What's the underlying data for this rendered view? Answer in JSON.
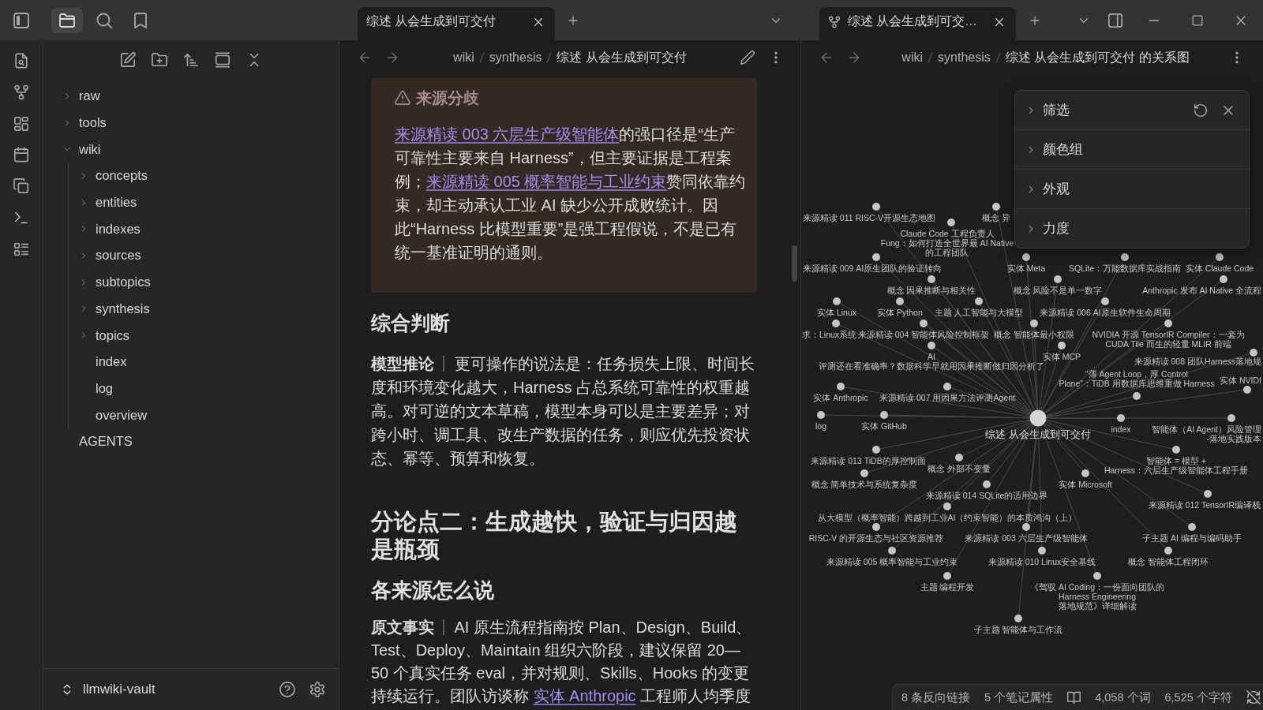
{
  "left_header": {
    "tabs": [
      {
        "kind": "files",
        "selected": true
      },
      {
        "kind": "search",
        "selected": false
      },
      {
        "kind": "bookmarks",
        "selected": false
      }
    ]
  },
  "file_explorer": {
    "tree": [
      {
        "label": "raw",
        "kind": "folder",
        "expanded": false
      },
      {
        "label": "tools",
        "kind": "folder",
        "expanded": false
      },
      {
        "label": "wiki",
        "kind": "folder",
        "expanded": true,
        "children": [
          {
            "label": "concepts",
            "kind": "folder",
            "expanded": false
          },
          {
            "label": "entities",
            "kind": "folder",
            "expanded": false
          },
          {
            "label": "indexes",
            "kind": "folder",
            "expanded": false
          },
          {
            "label": "sources",
            "kind": "folder",
            "expanded": false
          },
          {
            "label": "subtopics",
            "kind": "folder",
            "expanded": false
          },
          {
            "label": "synthesis",
            "kind": "folder",
            "expanded": false
          },
          {
            "label": "topics",
            "kind": "folder",
            "expanded": false
          },
          {
            "label": "index",
            "kind": "file"
          },
          {
            "label": "log",
            "kind": "file"
          },
          {
            "label": "overview",
            "kind": "file"
          }
        ]
      },
      {
        "label": "AGENTS",
        "kind": "file"
      }
    ],
    "vault": "llmwiki-vault"
  },
  "main_pane": {
    "tab": {
      "title": "综述 从会生成到可交付",
      "selected": true
    },
    "breadcrumb": [
      "wiki",
      "synthesis",
      "综述 从会生成到可交付"
    ],
    "blocks": [
      {
        "kind": "callout",
        "title": "来源分歧",
        "segments": [
          {
            "kind": "link",
            "text": "来源精读 003 六层生产级智能体"
          },
          {
            "kind": "text",
            "text": "的强口径是“生产可靠性主要来自 Harness”，但主要证据是工程案例；"
          },
          {
            "kind": "link",
            "text": "来源精读 005 概率智能与工业约束"
          },
          {
            "kind": "text",
            "text": "赞同依靠约束，却主动承认工业 AI 缺少公开成败统计。因此“Harness 比模型重要”是强工程假说，不是已有统一基准证明的通则。"
          }
        ]
      },
      {
        "kind": "h4",
        "text": "综合判断"
      },
      {
        "kind": "paragraph",
        "label": "模型推论",
        "segments": [
          {
            "kind": "text",
            "text": "更可操作的说法是：任务损失上限、时间长度和环境变化越大，Harness 占总系统可靠性的权重越高。对可逆的文本草稿，模型本身可以是主要差异；对跨小时、调工具、改生产数据的任务，则应优先投资状态、幂等、预算和恢复。"
          }
        ]
      },
      {
        "kind": "h2",
        "text": "分论点二：生成越快，验证与归因越是瓶颈"
      },
      {
        "kind": "h3",
        "text": "各来源怎么说"
      },
      {
        "kind": "paragraph",
        "label": "原文事实",
        "segments": [
          {
            "kind": "text",
            "text": "AI 原生流程指南按 Plan、Design、Build、Test、Deploy、Maintain 组织六阶段，建议保留 20—50 个真实任务 eval，并对规则、Skills、Hooks 的变更持续运行。团队访谈称 "
          },
          {
            "kind": "link",
            "text": "实体 Anthropic"
          },
          {
            "kind": "text",
            "text": " 工程师人均季度"
          }
        ]
      }
    ]
  },
  "graph_pane": {
    "tab": {
      "title": "综述 从会生成到可交…",
      "selected": true
    },
    "breadcrumb": [
      "wiki",
      "synthesis",
      "综述 从会生成到可交付 的关系图"
    ],
    "settings": [
      {
        "label": "筛选",
        "expanded": false
      },
      {
        "label": "颜色组",
        "expanded": false
      },
      {
        "label": "外观",
        "expanded": false
      },
      {
        "label": "力度",
        "expanded": false
      }
    ],
    "nodes": [
      {
        "lines": [
          "来源精读 011 RISC-V开源生态地图"
        ],
        "current": false
      },
      {
        "lines": [
          "概念 异"
        ],
        "current": false
      },
      {
        "lines": [
          "Claude Code 工程负责人",
          "Fung：如何打造全世界最 AI Native",
          "的工程团队"
        ],
        "current": false
      },
      {
        "lines": [
          "来源精读 009 AI原生团队的验证转向"
        ],
        "current": false
      },
      {
        "lines": [
          "实体 Meta"
        ],
        "current": false
      },
      {
        "lines": [
          "SQLite：万能数据库实战指南"
        ],
        "current": false
      },
      {
        "lines": [
          "实体 Claude Code"
        ],
        "current": false
      },
      {
        "lines": [
          "概念 因果推断与相关性"
        ],
        "current": false
      },
      {
        "lines": [
          "概念 风险不是单一数字"
        ],
        "current": false
      },
      {
        "lines": [
          "Anthropic 发布 AI Native 全流程"
        ],
        "current": false
      },
      {
        "lines": [
          "实体 Linux"
        ],
        "current": false
      },
      {
        "lines": [
          "实体 Python"
        ],
        "current": false
      },
      {
        "lines": [
          "主题 人工智能与大模型"
        ],
        "current": false
      },
      {
        "lines": [
          "来源精读 006 AI原生软件生命周期"
        ],
        "current": false
      },
      {
        "lines": [
          "求：Linux系统"
        ],
        "current": false
      },
      {
        "lines": [
          "来源精读 004 智能体风险控制框架"
        ],
        "current": false
      },
      {
        "lines": [
          "概念 智能体最小权限"
        ],
        "current": false
      },
      {
        "lines": [
          "NVIDIA 开源 TensorIR Compiler：一套为",
          "CUDA Tile 而生的轻量 MLIR 前端"
        ],
        "current": false
      },
      {
        "lines": [
          "AI",
          "评测还在看准确率？数据科学早就用因果推断做归因分析了"
        ],
        "current": false
      },
      {
        "lines": [
          "实体 MCP"
        ],
        "current": false
      },
      {
        "lines": [
          "来源精读 008 团队Harness落地规"
        ],
        "current": false
      },
      {
        "lines": [
          "“薄 Agent Loop，厚 Control",
          "Plane”：TiDB 用数据库思维重做 Harness"
        ],
        "current": false
      },
      {
        "lines": [
          "实体 NVIDI"
        ],
        "current": false
      },
      {
        "lines": [
          "实体 Anthropic"
        ],
        "current": false
      },
      {
        "lines": [
          "来源精读 007 用因果方法评测Agent"
        ],
        "current": false
      },
      {
        "lines": [
          "log"
        ],
        "current": false
      },
      {
        "lines": [
          "实体 GitHub"
        ],
        "current": false
      },
      {
        "lines": [
          "综述 从会生成到可交付"
        ],
        "current": true
      },
      {
        "lines": [
          "index"
        ],
        "current": false
      },
      {
        "lines": [
          "智能体（AI Agent）风险管理",
          "-落地实践版本"
        ],
        "current": false
      },
      {
        "lines": [
          "来源精读 013 TiDB的厚控制面"
        ],
        "current": false
      },
      {
        "lines": [
          "概念 外部不变量"
        ],
        "current": false
      },
      {
        "lines": [
          "智能体 = 模型 +",
          "Harness：六层生产级智能体工程手册"
        ],
        "current": false
      },
      {
        "lines": [
          "概念 简单技术与系统复杂度"
        ],
        "current": false
      },
      {
        "lines": [
          "实体 Microsoft"
        ],
        "current": false
      },
      {
        "lines": [
          "来源精读 014 SQLite的适用边界"
        ],
        "current": false
      },
      {
        "lines": [
          "来源精读 012 TensorIR编译栈"
        ],
        "current": false
      },
      {
        "lines": [
          "从大模型（概率智能）跨越到工业AI（约束智能）的本质鸿沟（上）"
        ],
        "current": false
      },
      {
        "lines": [
          "RISC-V 的开源生态与社区资源推荐"
        ],
        "current": false
      },
      {
        "lines": [
          "来源精读 003 六层生产级智能体"
        ],
        "current": false
      },
      {
        "lines": [
          "子主题 AI 编程与编码助手"
        ],
        "current": false
      },
      {
        "lines": [
          "来源精读 005 概率智能与工业约束"
        ],
        "current": false
      },
      {
        "lines": [
          "来源精读 010 Linux安全基线"
        ],
        "current": false
      },
      {
        "lines": [
          "概念 智能体工程闭环"
        ],
        "current": false
      },
      {
        "lines": [
          "主题 编程开发"
        ],
        "current": false
      },
      {
        "lines": [
          "《驾驭 AI Coding：一份面向团队的",
          "Harness Engineering",
          "落地规范》详细解读"
        ],
        "current": false
      },
      {
        "lines": [
          "子主题 智能体与工作流"
        ],
        "current": false
      }
    ]
  },
  "status_bar": {
    "items": [
      "8 条反向链接",
      "5 个笔记属性",
      "4,058 个词",
      "6,525 个字符"
    ]
  }
}
